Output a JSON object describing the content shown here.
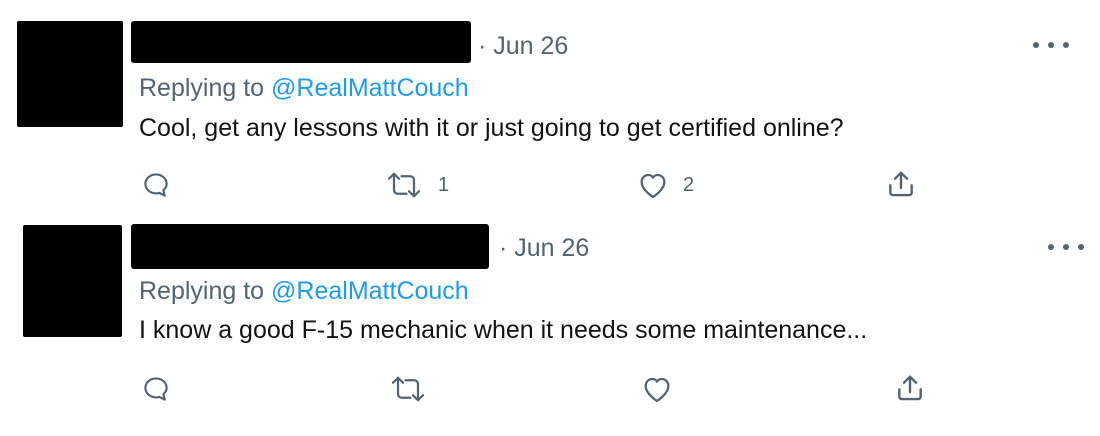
{
  "tweets": [
    {
      "date": "· Jun 26",
      "replying_prefix": "Replying to",
      "replying_handle": "@RealMattCouch",
      "text": "Cool, get any lessons with it or just going to get certified online?",
      "actions": {
        "reply_icon": "reply-bubble-icon",
        "retweet_icon": "retweet-icon",
        "retweet_count": "1",
        "like_icon": "heart-icon",
        "like_count": "2",
        "share_icon": "share-icon"
      },
      "more_icon": "more-dots-icon"
    },
    {
      "date": "· Jun 26",
      "replying_prefix": "Replying to",
      "replying_handle": "@RealMattCouch",
      "text": "I know a good F-15 mechanic when it needs some maintenance...",
      "actions": {
        "reply_icon": "reply-bubble-icon",
        "retweet_icon": "retweet-icon",
        "retweet_count": "",
        "like_icon": "heart-icon",
        "like_count": "",
        "share_icon": "share-icon"
      },
      "more_icon": "more-dots-icon"
    }
  ],
  "colors": {
    "link_blue": "#1d9bf0",
    "secondary_text": "#536471",
    "primary_text": "#0f1419",
    "redaction": "#000000"
  }
}
